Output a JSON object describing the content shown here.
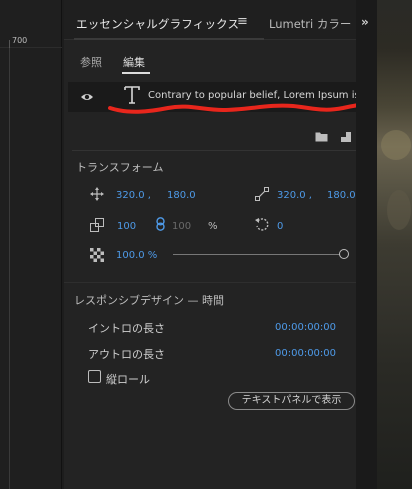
{
  "timeline": {
    "ruler_label": "700"
  },
  "panel": {
    "tab_active": "エッセンシャルグラフィックス",
    "tab_menu_icon": "hamburger-icon",
    "tab_other": "Lumetri カラー",
    "overflow_icon": "chevron-double-right-icon"
  },
  "subtabs": {
    "browse": "参照",
    "edit": "編集"
  },
  "layer": {
    "text": "Contrary to popular belief, Lorem Ipsum is no..."
  },
  "transform": {
    "title": "トランスフォーム",
    "position_x": "320.0 ,",
    "position_y": "180.0",
    "anchor_x": "320.0 ,",
    "anchor_y": "180.0",
    "scale": "100",
    "scale_linked": "100",
    "scale_unit": "%",
    "rotation": "0",
    "opacity": "100.0 %"
  },
  "responsive": {
    "title": "レスポンシブデザイン — 時間",
    "intro_label": "イントロの長さ",
    "intro_value": "00:00:00:00",
    "outro_label": "アウトロの長さ",
    "outro_value": "00:00:00:00",
    "roll_label": "縦ロール",
    "text_panel_button": "テキストパネルで表示"
  },
  "colors": {
    "accent": "#4e9ae8",
    "annotation": "#e8261c"
  }
}
